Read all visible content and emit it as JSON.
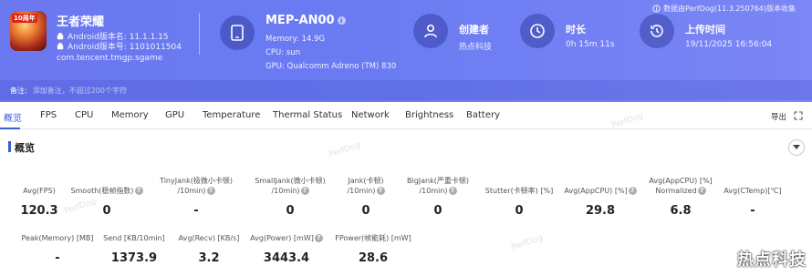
{
  "app": {
    "name": "王者荣耀",
    "icon_badge": "10周年",
    "android_version_name": "Android版本名: 11.1.1.15",
    "android_version_code": "Android版本号: 1101011504",
    "package": "com.tencent.tmgp.sgame"
  },
  "device": {
    "name": "MEP-AN00",
    "memory": "Memory: 14.9G",
    "cpu": "CPU: sun",
    "gpu": "GPU: Qualcomm Adreno (TM) 830"
  },
  "creator": {
    "title": "创建者",
    "value": "热点科技"
  },
  "duration": {
    "title": "时长",
    "value": "0h 15m 11s"
  },
  "upload": {
    "title": "上传时间",
    "value": "19/11/2025 16:56:04"
  },
  "version_note": "数据由PerfDog(11.3.250764)版本收集",
  "note": {
    "label": "备注:",
    "placeholder": "添加备注，不超过200个字符"
  },
  "tabs": [
    "概览",
    "FPS",
    "CPU",
    "Memory",
    "GPU",
    "Temperature",
    "Thermal Status",
    "Network",
    "Brightness",
    "Battery"
  ],
  "export_label": "导出",
  "watermark": "PerfDog",
  "section_title": "概览",
  "metrics_row1": [
    {
      "label1": "Avg(FPS)",
      "label2": "",
      "value": "120.3",
      "help": false
    },
    {
      "label1": "Smooth(稳帧指数)",
      "label2": "",
      "value": "0",
      "help": true
    },
    {
      "label1": "TinyJank(极微小卡顿)",
      "label2": "/10min)",
      "value": "-",
      "help": true
    },
    {
      "label1": "SmallJank(微小卡顿)",
      "label2": "/10min)",
      "value": "0",
      "help": true
    },
    {
      "label1": "Jank(卡顿)",
      "label2": "/10min)",
      "value": "0",
      "help": true
    },
    {
      "label1": "BigJank(严重卡顿)",
      "label2": "/10min)",
      "value": "0",
      "help": true
    },
    {
      "label1": "Stutter(卡顿率) [%]",
      "label2": "",
      "value": "0",
      "help": false
    },
    {
      "label1": "Avg(AppCPU) [%]",
      "label2": "",
      "value": "29.8",
      "help": true
    },
    {
      "label1": "Avg(AppCPU) [%]",
      "label2": "Normalized",
      "value": "6.8",
      "help": true
    },
    {
      "label1": "Avg(CTemp)[℃]",
      "label2": "",
      "value": "-",
      "help": false
    }
  ],
  "metrics_row2": [
    {
      "label1": "Peak(Memory) [MB]",
      "value": "-",
      "help": false
    },
    {
      "label1": "Send [KB/10min]",
      "value": "1373.9",
      "help": false
    },
    {
      "label1": "Avg(Recv) [KB/s]",
      "value": "3.2",
      "help": false
    },
    {
      "label1": "Avg(Power) [mW]",
      "value": "3443.4",
      "help": true
    },
    {
      "label1": "FPower(帧能耗) [mW]",
      "value": "28.6",
      "help": false
    }
  ],
  "corner_watermark": "热点科技",
  "colors": {
    "header": "#6b78f0",
    "accent": "#3b5bdb"
  }
}
